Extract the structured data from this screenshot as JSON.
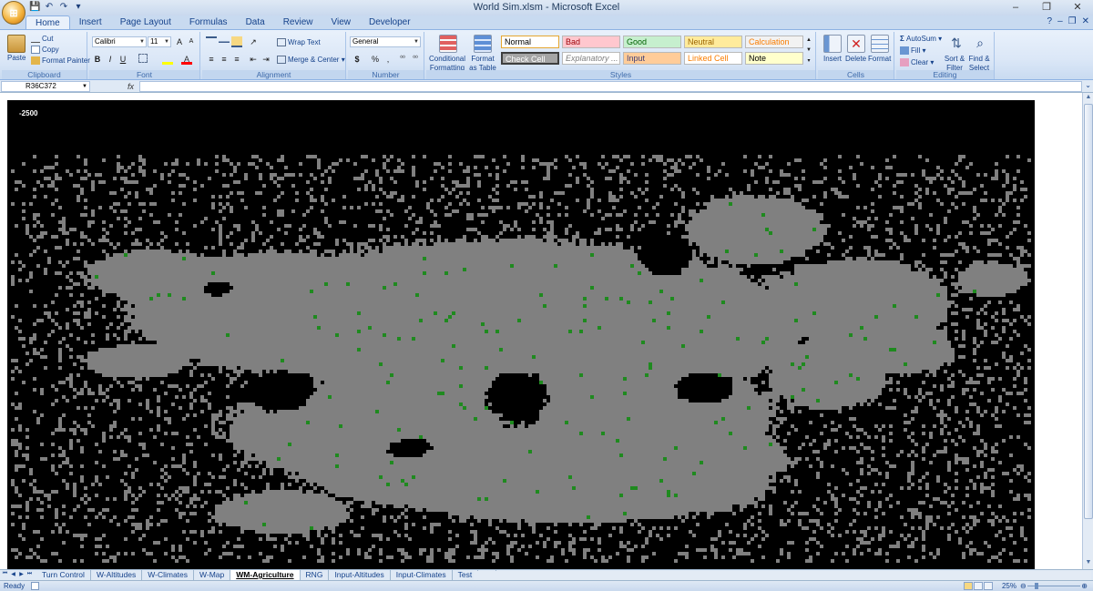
{
  "window": {
    "title": "World Sim.xlsm - Microsoft Excel",
    "controls": [
      "–",
      "❐",
      "✕"
    ],
    "office_button": "⊞"
  },
  "qat": [
    "💾",
    "↶",
    "↷",
    "▾"
  ],
  "ribbon_tabs": [
    "Home",
    "Insert",
    "Page Layout",
    "Formulas",
    "Data",
    "Review",
    "View",
    "Developer"
  ],
  "active_tab": "Home",
  "ribbon_right": [
    "?",
    "–",
    "❐",
    "✕"
  ],
  "clipboard": {
    "label": "Clipboard",
    "paste": "Paste",
    "cut": "Cut",
    "copy": "Copy",
    "format_painter": "Format Painter"
  },
  "font": {
    "label": "Font",
    "family": "Calibri",
    "size": "11",
    "bold": "B",
    "italic": "I",
    "underline": "U"
  },
  "alignment": {
    "label": "Alignment",
    "wrap_text": "Wrap Text",
    "merge_center": "Merge & Center"
  },
  "number": {
    "label": "Number",
    "format": "General",
    "currency": "$",
    "percent": "%",
    "comma": ","
  },
  "styles": {
    "label": "Styles",
    "conditional": "Conditional",
    "formatting": "Formatting",
    "format": "Format",
    "as_table": "as Table",
    "cells": [
      {
        "name": "Normal",
        "bg": "#ffffff",
        "fg": "#000000"
      },
      {
        "name": "Bad",
        "bg": "#ffc7ce",
        "fg": "#9c0006"
      },
      {
        "name": "Good",
        "bg": "#c6efce",
        "fg": "#006100"
      },
      {
        "name": "Neutral",
        "bg": "#ffeb9c",
        "fg": "#9c6500"
      },
      {
        "name": "Calculation",
        "bg": "#f2f2f2",
        "fg": "#fa7d00"
      },
      {
        "name": "Check Cell",
        "bg": "#a5a5a5",
        "fg": "#ffffff"
      },
      {
        "name": "Explanatory ...",
        "bg": "#ffffff",
        "fg": "#7f7f7f"
      },
      {
        "name": "Input",
        "bg": "#ffcc99",
        "fg": "#3f3f76"
      },
      {
        "name": "Linked Cell",
        "bg": "#ffffff",
        "fg": "#fa7d00"
      },
      {
        "name": "Note",
        "bg": "#ffffcc",
        "fg": "#000000"
      }
    ]
  },
  "cells_group": {
    "label": "Cells",
    "insert": "Insert",
    "delete": "Delete",
    "format": "Format"
  },
  "editing": {
    "label": "Editing",
    "autosum": "AutoSum",
    "fill": "Fill",
    "clear": "Clear",
    "sort_filter": "Sort &",
    "filter": "Filter",
    "find_select": "Find &",
    "select": "Select"
  },
  "formula_bar": {
    "name_box": "R36C372",
    "fx": "fx",
    "value": ""
  },
  "sheet": {
    "cell_value": "-2500",
    "map_colors": {
      "water": "#000000",
      "land": "#808080",
      "agriculture": "#1f8a1f"
    }
  },
  "sheet_tabs": [
    "Turn Control",
    "W-Altitudes",
    "W-Climates",
    "W-Map",
    "WM-Agriculture",
    "RNG",
    "Input-Altitudes",
    "Input-Climates",
    "Test"
  ],
  "active_sheet": "WM-Agriculture",
  "status": {
    "ready": "Ready",
    "zoom": "25%"
  }
}
